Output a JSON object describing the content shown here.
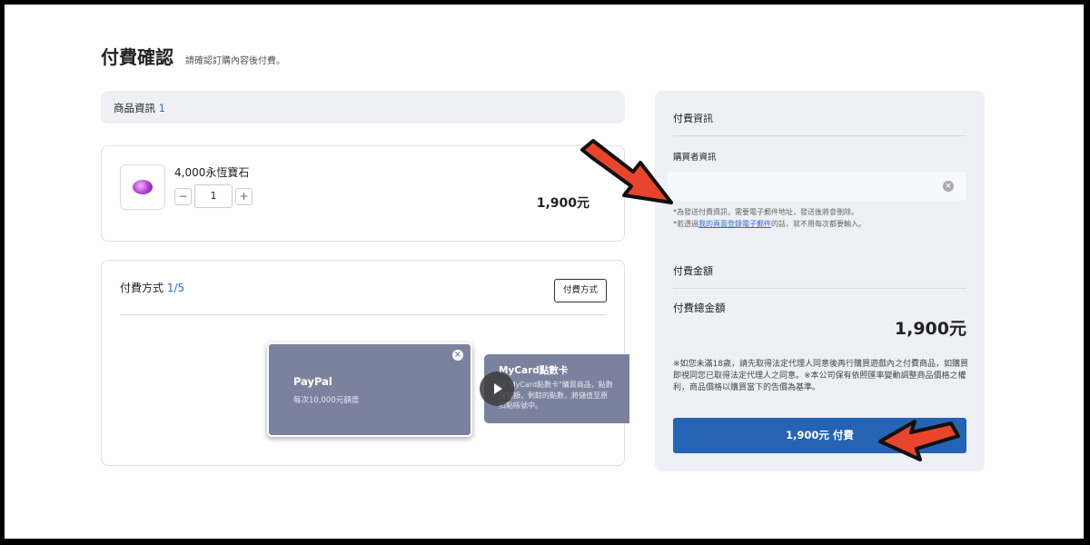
{
  "page": {
    "title": "付費確認",
    "subtitle": "請確認訂購內容後付費。"
  },
  "product_section": {
    "label": "商品資訊",
    "count": "1",
    "item": {
      "name": "4,000永恆寶石",
      "quantity": "1",
      "minus": "−",
      "plus": "+",
      "price": "1,900元"
    }
  },
  "payment_method": {
    "label": "付費方式",
    "current": "1",
    "total": "/5",
    "button_label": "付費方式",
    "options": [
      {
        "name": "PayPal",
        "desc": "每次10,000元額度"
      },
      {
        "name": "MyCard點數卡",
        "desc_lines": [
          "以\"MyCard點數卡\"購買商品，點數",
          "最高額，剩餘的點數，將儲值至原",
          "扣點帳號中。"
        ]
      }
    ]
  },
  "payment_info": {
    "title": "付費資訊",
    "buyer_label": "購買者資訊",
    "buyer_value": "",
    "notes": [
      "*為發送付費資訊，需要電子郵件地址，發送後將會刪除。",
      "*若透過",
      "我的頁面登錄電子郵件",
      "的話，就不用每次都要輸入。"
    ],
    "amount_title": "付費金額",
    "total_label": "付費總金額",
    "total_value": "1,900元",
    "disclaimer": "※如您未滿18歲，請先取得法定代理人同意後再行購買遊戲內之付費商品，如購買即視同您已取得法定代理人之同意。※本公司保有依照匯率變動調整商品價格之權利，商品價格以購買當下的告價為基準。",
    "pay_button": "1,900元 付費"
  },
  "colors": {
    "accent": "#2563b5",
    "panel_bg": "#eef0f6",
    "method_card": "#7b829e",
    "annotation_arrow": "#e8452c"
  }
}
